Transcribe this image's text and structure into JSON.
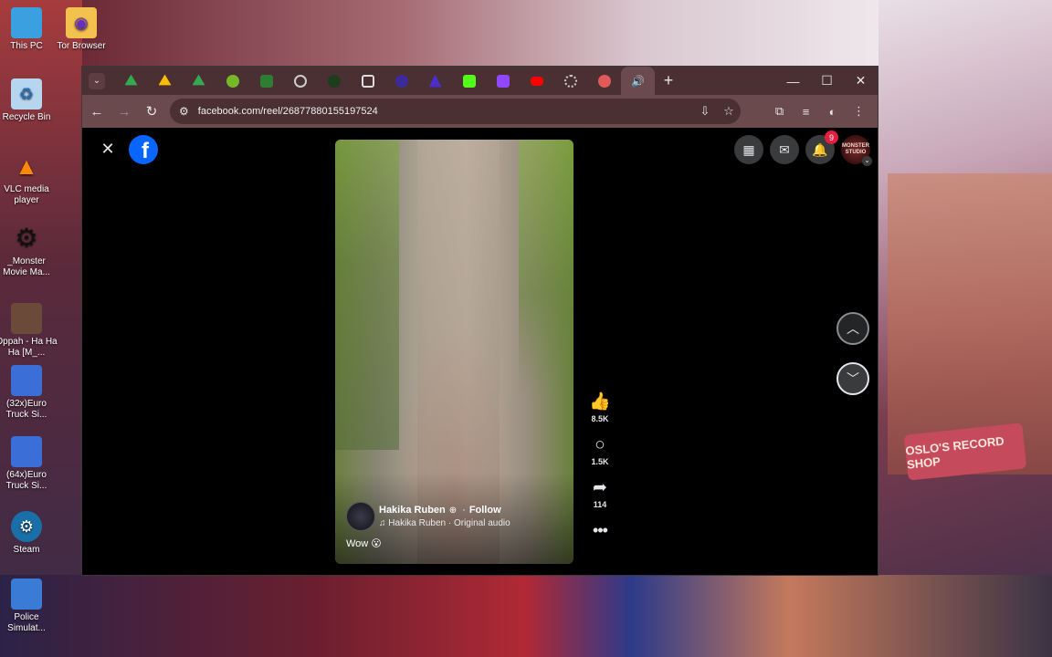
{
  "desktop": {
    "icons": [
      {
        "label": "This PC",
        "icon": "monitor-icon",
        "color": "#3aa0e0"
      },
      {
        "label": "Tor Browser",
        "icon": "tor-browser-icon",
        "color": "#f2c14e"
      },
      {
        "label": "Recycle Bin",
        "icon": "recycle-bin-icon",
        "color": "#b6d6f0"
      },
      {
        "label": "VLC media player",
        "icon": "vlc-icon",
        "color": "#ff8800"
      },
      {
        "label": "_Monster Movie Ma...",
        "icon": "gear-icon",
        "color": "#222222"
      },
      {
        "label": "Oppah - Ha Ha Ha [M_...",
        "icon": "video-file-icon",
        "color": "#6c4a3a"
      },
      {
        "label": "(32x)Euro Truck Si...",
        "icon": "euro-truck-icon",
        "color": "#3b6ed6"
      },
      {
        "label": "(64x)Euro Truck Si...",
        "icon": "euro-truck-icon",
        "color": "#3b6ed6"
      },
      {
        "label": "Steam",
        "icon": "steam-icon",
        "color": "#1b6fa8"
      },
      {
        "label": "Police Simulat...",
        "icon": "police-sim-icon",
        "color": "#3a7bd5"
      }
    ],
    "wallpaper_sign": "OSLO'S RECORD SHOP"
  },
  "browser": {
    "tabs": [
      {
        "icon": "google-drive-icon",
        "color": "#34a853"
      },
      {
        "icon": "google-drive-icon",
        "color": "#fbbc04"
      },
      {
        "icon": "google-drive-icon",
        "color": "#34a853"
      },
      {
        "icon": "utorrent-icon",
        "color": "#77b82a"
      },
      {
        "icon": "st-icon",
        "color": "#2e7d32"
      },
      {
        "icon": "globe-icon",
        "color": "#cccccc"
      },
      {
        "icon": "app-icon",
        "color": "#1e3d1e"
      },
      {
        "icon": "image-icon",
        "color": "#dddddd"
      },
      {
        "icon": "app-icon",
        "color": "#3b2a9a"
      },
      {
        "icon": "app-icon",
        "color": "#4b2ec7"
      },
      {
        "icon": "kick-icon",
        "color": "#53fc18"
      },
      {
        "icon": "twitch-icon",
        "color": "#9146ff"
      },
      {
        "icon": "youtube-icon",
        "color": "#ff0000"
      },
      {
        "icon": "loading-icon",
        "color": "#cccccc"
      },
      {
        "icon": "app-icon",
        "color": "#e05a5a"
      },
      {
        "icon": "speaker-icon",
        "color": "#dddddd",
        "active": true
      }
    ],
    "new_tab_symbol": "+",
    "window_controls": {
      "minimize": "—",
      "maximize": "☐",
      "close": "✕"
    },
    "url": "facebook.com/reel/26877880155197524",
    "accent": "#6b4a4e",
    "tabbar_color": "#4a2f33"
  },
  "facebook": {
    "close_symbol": "✕",
    "logo_letter": "f",
    "notifications_count": "9",
    "avatar_text": "MONSTER STUDIO",
    "brand_color": "#0866ff"
  },
  "reel": {
    "author": "Hakika Ruben",
    "follow_label": "Follow",
    "audio": "Hakika Ruben · Original audio",
    "caption": "Wow 😮",
    "likes": "8.5K",
    "comments": "1.5K",
    "shares": "114"
  }
}
